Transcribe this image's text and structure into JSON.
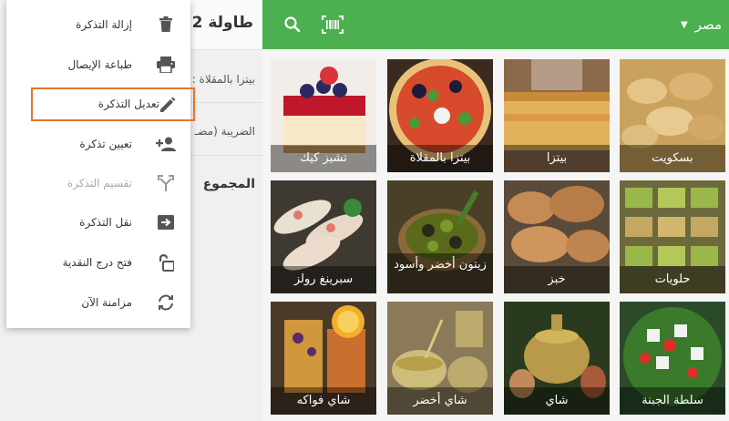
{
  "topbar": {
    "category_label": "مصر",
    "search_icon": "search-icon",
    "barcode_icon": "barcode-scan-icon",
    "color": "#4caf50"
  },
  "ticket": {
    "table_title": "طاولة 2",
    "line_item": "بيتزا بالمقلاة :",
    "tax_label": "الضريبة (مضـ",
    "total_label": "المجموع"
  },
  "menu": {
    "items": [
      {
        "label": "إزالة التذكرة",
        "icon": "trash-icon",
        "disabled": false,
        "highlighted": false
      },
      {
        "label": "طباعة الإيصال",
        "icon": "printer-icon",
        "disabled": false,
        "highlighted": false
      },
      {
        "label": "تعديل التذكرة",
        "icon": "pencil-icon",
        "disabled": false,
        "highlighted": true
      },
      {
        "label": "تعيين تذكرة",
        "icon": "add-user-icon",
        "disabled": false,
        "highlighted": false
      },
      {
        "label": "تقسيم التذكرة",
        "icon": "split-icon",
        "disabled": true,
        "highlighted": false
      },
      {
        "label": "نقل التذكرة",
        "icon": "move-arrow-icon",
        "disabled": false,
        "highlighted": false
      },
      {
        "label": "فتح درج النقدية",
        "icon": "unlock-icon",
        "disabled": false,
        "highlighted": false
      },
      {
        "label": "مزامنة الآن",
        "icon": "sync-icon",
        "disabled": false,
        "highlighted": false
      }
    ],
    "highlight_color": "#e8742b"
  },
  "products": [
    {
      "name": "تشيز كيك"
    },
    {
      "name": "بيتزا بالمقلاة"
    },
    {
      "name": "بيتزا"
    },
    {
      "name": "بسكويت"
    },
    {
      "name": "سبرينغ رولز"
    },
    {
      "name": "زيتون أخضر وأسود"
    },
    {
      "name": "خبز"
    },
    {
      "name": "حلويات"
    },
    {
      "name": "شاي فواكه"
    },
    {
      "name": "شاي أخضر"
    },
    {
      "name": "شاي"
    },
    {
      "name": "سلطة الجبنة"
    }
  ]
}
